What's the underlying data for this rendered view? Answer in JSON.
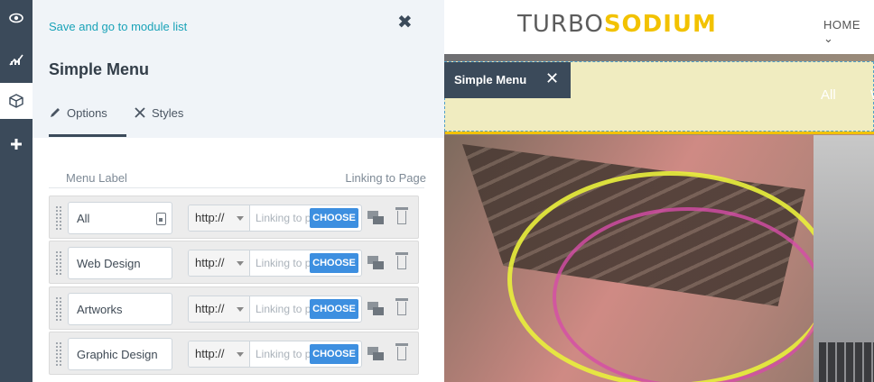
{
  "rail": {
    "icons": [
      "eye-icon",
      "chart-icon",
      "cube-icon",
      "plus-icon"
    ]
  },
  "panel": {
    "save_link": "Save and go to module list",
    "title": "Simple Menu",
    "tabs": [
      {
        "label": "Options",
        "icon": "pencil-icon",
        "active": true
      },
      {
        "label": "Styles",
        "icon": "styles-icon",
        "active": false
      }
    ],
    "columns": {
      "menu_label": "Menu Label",
      "link": "Linking to Page"
    },
    "items": [
      {
        "label": "All",
        "protocol": "http://",
        "link_placeholder": "Linking to p",
        "choose": "CHOOSE"
      },
      {
        "label": "Web Design",
        "protocol": "http://",
        "link_placeholder": "Linking to p",
        "choose": "CHOOSE"
      },
      {
        "label": "Artworks",
        "protocol": "http://",
        "link_placeholder": "Linking to p",
        "choose": "CHOOSE"
      },
      {
        "label": "Graphic Design",
        "protocol": "http://",
        "link_placeholder": "Linking to p",
        "choose": "CHOOSE"
      }
    ]
  },
  "site": {
    "logo_a": "TURBO",
    "logo_b": "SODIUM",
    "nav_home": "HOME",
    "menu_tag": "Simple Menu",
    "menu_all": "All",
    "menu_more": "W"
  },
  "colors": {
    "accent": "#1aa3b8",
    "rail": "#3b4a5a",
    "choose": "#3d8fe0",
    "logo_yellow": "#f2c200"
  }
}
